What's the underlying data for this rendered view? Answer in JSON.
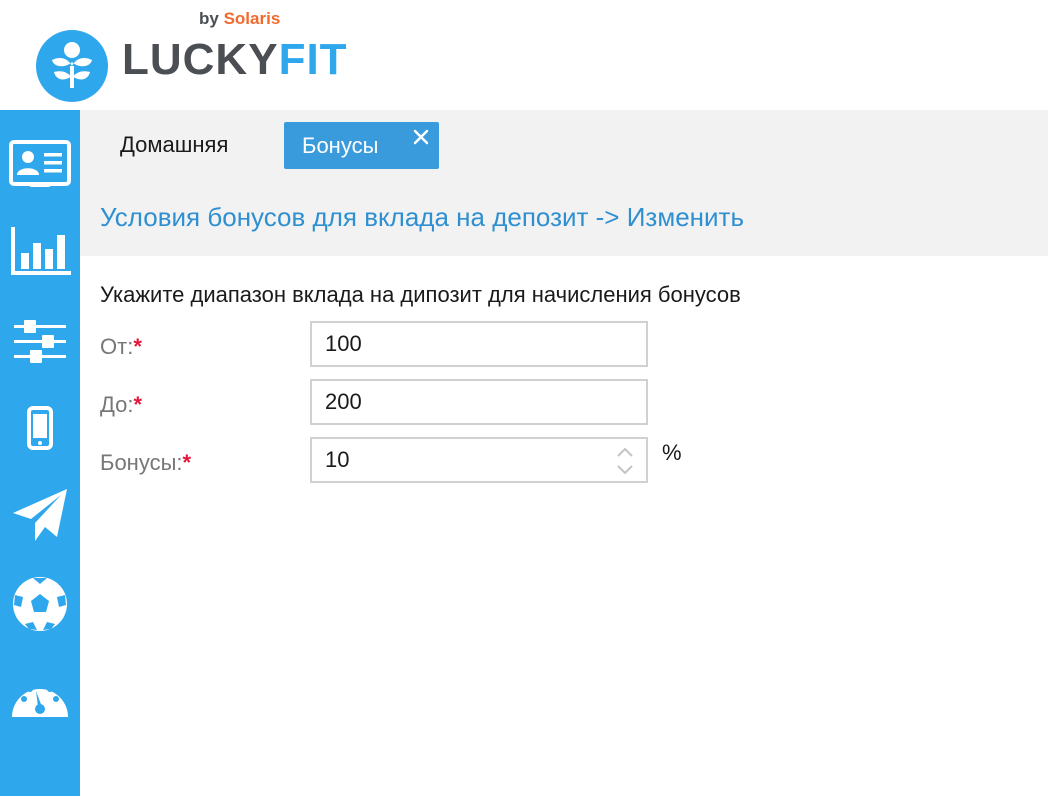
{
  "brand": {
    "name_part1": "LUCKY",
    "name_part2": "FIT",
    "by_label": "by",
    "by_company": "Solaris",
    "colors": {
      "primary": "#2ea7ec",
      "dark": "#4b4f54",
      "accent": "#f26a2e"
    }
  },
  "sidebar": {
    "items": [
      {
        "icon": "id-card-icon"
      },
      {
        "icon": "bar-chart-icon"
      },
      {
        "icon": "sliders-icon"
      },
      {
        "icon": "mobile-phone-icon"
      },
      {
        "icon": "paper-plane-icon"
      },
      {
        "icon": "soccer-ball-icon"
      },
      {
        "icon": "speedometer-icon"
      }
    ]
  },
  "tabs": {
    "home_label": "Домашняя",
    "active_label": "Бонусы"
  },
  "page": {
    "title": "Условия бонусов для вклада на депозит -> Изменить"
  },
  "form": {
    "description": "Укажите диапазон вклада на дипозит для начисления бонусов",
    "required_mark": "*",
    "fields": [
      {
        "label": "От:",
        "value": "100"
      },
      {
        "label": "До:",
        "value": "200"
      },
      {
        "label": "Бонусы:",
        "value": "10"
      }
    ],
    "bonus_suffix": "%"
  }
}
